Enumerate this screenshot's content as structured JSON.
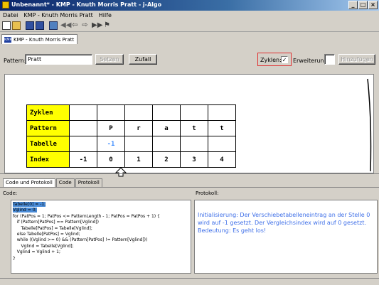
{
  "window": {
    "title": "Unbenannt* - KMP - Knuth Morris Pratt - j-Algo"
  },
  "menu": [
    "Datei",
    "KMP - Knuth Morris Pratt",
    "Hilfe"
  ],
  "doc_tab": {
    "label": "KMP - Knuth Morris Pratt",
    "icon_text": "KMP"
  },
  "controls": {
    "pattern_label": "Pattern:",
    "pattern_value": "Pratt",
    "setzen_label": "Setzen",
    "zufall_label": "Zufall",
    "zyklen_label": "Zyklen:",
    "zyklen_checked": "✓",
    "erweiterung_label": "Erweiterung:",
    "hinzufuegen_label": "Hinzufügen"
  },
  "table": {
    "row_headers": [
      "Zyklen",
      "Pattern",
      "Tabelle",
      "Index"
    ],
    "zyklen": [
      "",
      "",
      "",
      "",
      "",
      ""
    ],
    "pattern": [
      "",
      "P",
      "r",
      "a",
      "t",
      "t"
    ],
    "tabelle": [
      "",
      "-1",
      "",
      "",
      "",
      ""
    ],
    "index": [
      "-1",
      "0",
      "1",
      "2",
      "3",
      "4"
    ]
  },
  "bottom_tabs": [
    "Code und Protokoll",
    "Code",
    "Protokoll"
  ],
  "code": {
    "label": "Code:",
    "lines": [
      "Tabelle[0] = -1;",
      "Vglind = 0;",
      "for (PatPos = 1; PatPos <= PatternLength - 1; PatPos = PatPos + 1) {",
      "   if (Pattern[PatPos] == Pattern[Vglind])",
      "      Tabelle[PatPos] = Tabelle[Vglind];",
      "   else Tabelle[PatPos] = Vglind;",
      "   while ((Vglind >= 0) && (Pattern[PatPos] != Pattern[Vglind]))",
      "      Vglind = Tabelle[Vglind];",
      "   Vglind = Vglind + 1;",
      "}"
    ]
  },
  "protokoll": {
    "label": "Protokoll:",
    "text": "Initialisierung: Der Verschiebetabelleneintrag an der Stelle 0 wird auf -1 gesetzt. Der Vergleichsindex wird auf 0 gesetzt. Bedeutung: Es geht los!"
  },
  "colors": {
    "row_header_bg": "#ffff00",
    "tabelle_value": "#3c8cff",
    "protokoll_text": "#3e6fe8",
    "code_highlight": "#4a8cd8",
    "zyklen_box": "#e03030"
  }
}
